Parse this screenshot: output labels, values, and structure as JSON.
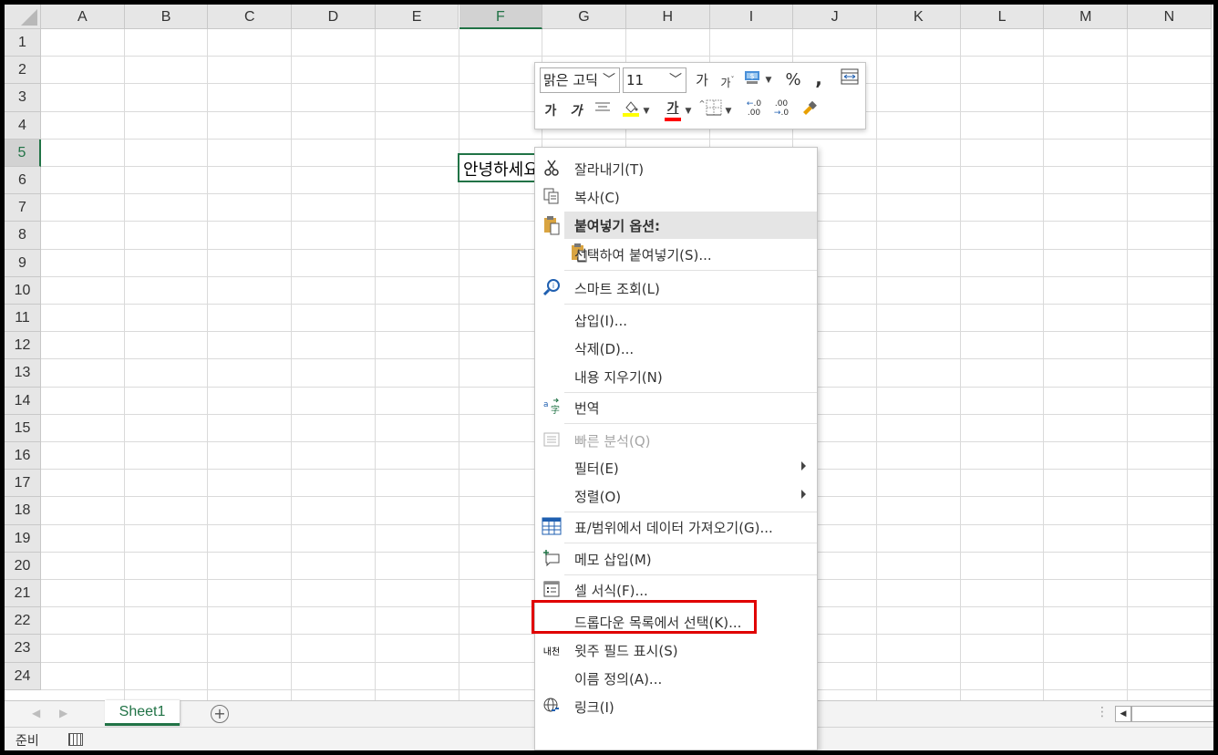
{
  "columns": [
    "A",
    "B",
    "C",
    "D",
    "E",
    "F",
    "G",
    "H",
    "I",
    "J",
    "K",
    "L",
    "M",
    "N"
  ],
  "selected_column": "F",
  "rows": [
    "1",
    "2",
    "3",
    "4",
    "5",
    "6",
    "7",
    "8",
    "9",
    "10",
    "11",
    "12",
    "13",
    "14",
    "15",
    "16",
    "17",
    "18",
    "19",
    "20",
    "21",
    "22",
    "23",
    "24"
  ],
  "selected_row": "5",
  "active_cell": {
    "ref": "F5",
    "value": "안녕하세요"
  },
  "sheet_tabs": {
    "active": "Sheet1"
  },
  "status": {
    "text": "준비"
  },
  "mini_toolbar": {
    "font_name": "맑은 고딕",
    "font_size": "11",
    "grow_font": "가",
    "shrink_font": "가",
    "percent": "%",
    "comma": ",",
    "bold": "가",
    "italic": "가",
    "font_color_letter": "가",
    "highlight_color": "#ffff00",
    "font_color": "#ff0000",
    "increase_decimal": ".00",
    "decrease_decimal": ".0"
  },
  "context_menu": {
    "items": [
      {
        "label": "잘라내기(T)",
        "icon": "scissors-icon"
      },
      {
        "label": "복사(C)",
        "icon": "copy-icon"
      },
      {
        "label": "붙여넣기 옵션:",
        "icon": "paste-icon",
        "header": true
      },
      {
        "label": "선택하여 붙여넣기(S)..."
      },
      {
        "label": "스마트 조회(L)",
        "icon": "search-icon"
      },
      {
        "label": "삽입(I)..."
      },
      {
        "label": "삭제(D)..."
      },
      {
        "label": "내용 지우기(N)"
      },
      {
        "label": "번역",
        "icon": "translate-icon"
      },
      {
        "label": "빠른 분석(Q)",
        "icon": "quick-analysis-icon",
        "disabled": true
      },
      {
        "label": "필터(E)",
        "submenu": true
      },
      {
        "label": "정렬(O)",
        "submenu": true
      },
      {
        "label": "표/범위에서 데이터 가져오기(G)...",
        "icon": "table-icon"
      },
      {
        "label": "메모 삽입(M)",
        "icon": "comment-icon"
      },
      {
        "label": "셀 서식(F)...",
        "icon": "format-cells-icon",
        "highlighted_by_box": true
      },
      {
        "label": "드롭다운 목록에서 선택(K)..."
      },
      {
        "label": "윗주 필드 표시(S)",
        "icon": "phonetic-icon"
      },
      {
        "label": "이름 정의(A)..."
      },
      {
        "label": "링크(I)",
        "icon": "link-icon"
      }
    ],
    "phonetic_icon_text": "내천"
  },
  "colors": {
    "accent": "#217346",
    "highlight_box": "#e00000"
  }
}
